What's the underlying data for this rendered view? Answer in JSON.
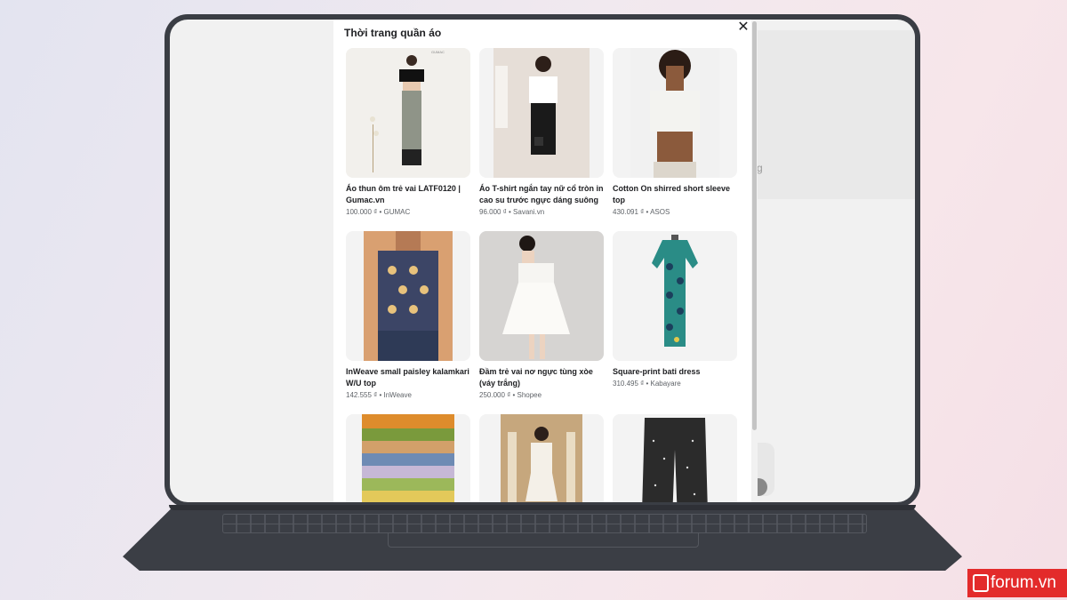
{
  "modal": {
    "title": "Thời trang quần áo",
    "close_glyph": "✕"
  },
  "background_hint": "g",
  "products": [
    {
      "title": "Áo thun ôm trẻ vai LATF0120 | Gumac.vn",
      "price": "100.000 ₫",
      "seller": "GUMAC",
      "brand_mark": "GUMAC"
    },
    {
      "title": "Áo T-shirt ngắn tay nữ cổ tròn in cao su trước ngực dáng suông rộng",
      "price": "96.000 ₫",
      "seller": "Savani.vn"
    },
    {
      "title": "Cotton On shirred short sleeve top",
      "price": "430.091 ₫",
      "seller": "ASOS"
    },
    {
      "title": "InWeave small paisley kalamkari W/U top",
      "price": "142.555 ₫",
      "seller": "InWeave"
    },
    {
      "title": "Đầm trẻ vai nơ ngực tùng xòe (váy trắng)",
      "price": "250.000 ₫",
      "seller": "Shopee"
    },
    {
      "title": "Square-print bati dress",
      "price": "310.495 ₫",
      "seller": "Kabayare"
    },
    {
      "title": "",
      "price": "",
      "seller": ""
    },
    {
      "title": "",
      "price": "",
      "seller": ""
    },
    {
      "title": "",
      "price": "",
      "seller": ""
    }
  ],
  "watermark": {
    "text": "forum.vn"
  },
  "colors": {
    "modal_bg": "#ffffff",
    "laptop": "#3a3d44",
    "screen": "#f1f1f1",
    "watermark": "#e32b2b"
  }
}
